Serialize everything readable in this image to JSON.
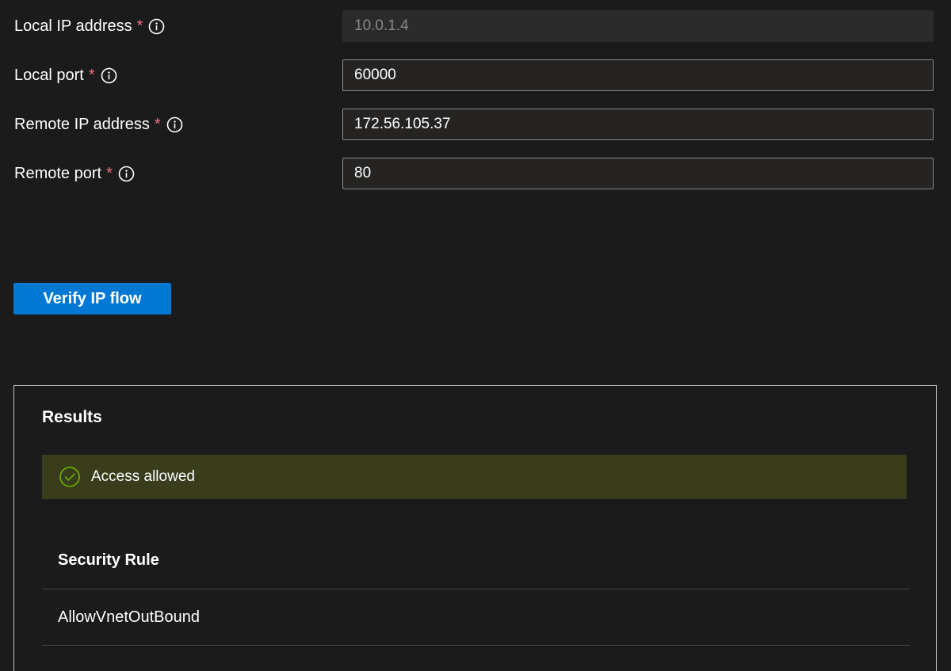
{
  "form": {
    "fields": [
      {
        "label": "Local IP address",
        "required_mark": "*",
        "value": "10.0.1.4",
        "disabled": true
      },
      {
        "label": "Local port",
        "required_mark": "*",
        "value": "60000",
        "disabled": false
      },
      {
        "label": "Remote IP address",
        "required_mark": "*",
        "value": "172.56.105.37",
        "disabled": false
      },
      {
        "label": "Remote port",
        "required_mark": "*",
        "value": "80",
        "disabled": false
      }
    ],
    "info_icon": "info-icon"
  },
  "actions": {
    "verify_label": "Verify IP flow"
  },
  "results": {
    "title": "Results",
    "status": {
      "icon": "check-circle-icon",
      "text": "Access allowed",
      "color": "#6bb700"
    },
    "table": {
      "header": "Security Rule",
      "rows": [
        "AllowVnetOutBound"
      ]
    }
  },
  "colors": {
    "background": "#1b1b1b",
    "accent": "#0078d4",
    "required": "#f1707b",
    "status_bg": "#393d1b"
  }
}
